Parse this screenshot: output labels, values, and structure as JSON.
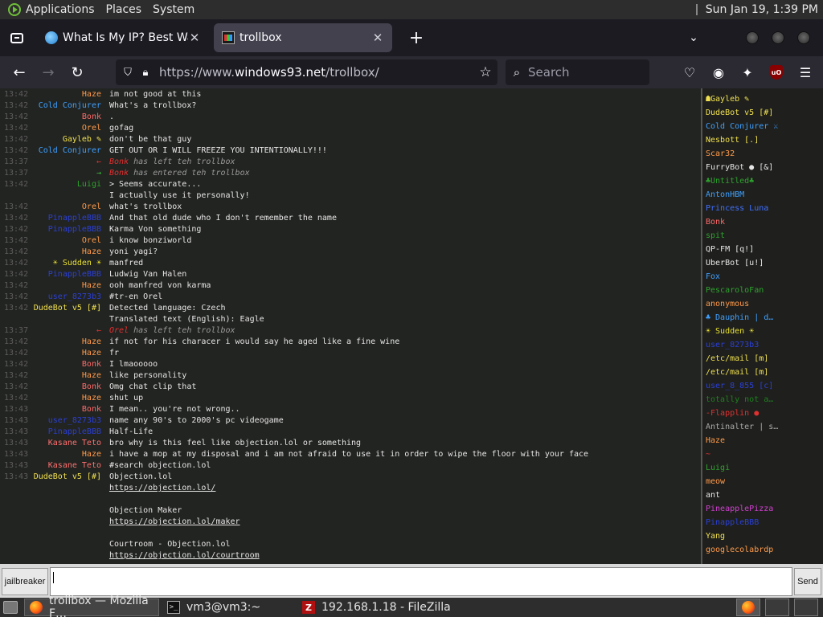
{
  "panel": {
    "menus": [
      "Applications",
      "Places",
      "System"
    ],
    "clock": "Sun Jan 19,  1:39 PM"
  },
  "tabs": [
    {
      "title": "What Is My IP? Best Way To",
      "icon": "globe-icon",
      "active": false
    },
    {
      "title": "trollbox",
      "icon": "trollbox-icon",
      "active": true
    }
  ],
  "nav": {
    "url_prefix": "https://www.",
    "url_host": "windows93.net",
    "url_path": "/trollbox/",
    "search_placeholder": "Search"
  },
  "messages": [
    {
      "time": "13:42",
      "nick": "Haze",
      "color": "#ff9a4a",
      "text": "im not good at this"
    },
    {
      "time": "13:42",
      "nick": "Cold Conjurer",
      "color": "#3fa0ff",
      "text": "What's a trollbox?"
    },
    {
      "time": "13:42",
      "nick": "Bonk",
      "color": "#ff6a6a",
      "text": "."
    },
    {
      "time": "13:42",
      "nick": "Orel",
      "color": "#ff9a4a",
      "text": "gofag"
    },
    {
      "time": "13:42",
      "nick": "Gayleb ✎",
      "color": "#f0e050",
      "text": "don't be that guy"
    },
    {
      "time": "13:42",
      "nick": "Cold Conjurer",
      "color": "#3fa0ff",
      "text": "GET OUT OR I WILL FREEZE YOU INTENTIONALLY!!!"
    },
    {
      "time": "13:37",
      "arrow": "←",
      "arrowColor": "#e03030",
      "sys": true,
      "who": "Bonk",
      "text": "has left teh trollbox"
    },
    {
      "time": "13:37",
      "arrow": "→",
      "arrowColor": "#3cc03c",
      "sys": true,
      "who": "Bonk",
      "text": "has entered teh trollbox"
    },
    {
      "time": "13:42",
      "nick": "Luigi",
      "color": "#2ea22e",
      "text": "> Seems accurate..."
    },
    {
      "time": "",
      "nick": "",
      "color": "#fff",
      "text": "I actually use it personally!"
    },
    {
      "time": "13:42",
      "nick": "Orel",
      "color": "#ff9a4a",
      "text": "what's trollbox"
    },
    {
      "time": "13:42",
      "nick": "PinappleBBB",
      "color": "#2b3fd6",
      "text": "And that old dude who I don't remember the name"
    },
    {
      "time": "13:42",
      "nick": "PinappleBBB",
      "color": "#2b3fd6",
      "text": "Karma Von something"
    },
    {
      "time": "13:42",
      "nick": "Orel",
      "color": "#ff9a4a",
      "text": "i know bonziworld"
    },
    {
      "time": "13:42",
      "nick": "Haze",
      "color": "#ff9a4a",
      "text": "yoni yagi?"
    },
    {
      "time": "13:42",
      "nick": "☀ Sudden ☀",
      "color": "#e8e030",
      "text": "manfred"
    },
    {
      "time": "13:42",
      "nick": "PinappleBBB",
      "color": "#2b3fd6",
      "text": "Ludwig Van Halen"
    },
    {
      "time": "13:42",
      "nick": "Haze",
      "color": "#ff9a4a",
      "text": "ooh manfred von karma"
    },
    {
      "time": "13:42",
      "nick": "user_8273b3",
      "color": "#2b3fd6",
      "text": "#tr-en Orel"
    },
    {
      "time": "13:42",
      "nick": "DudeBot v5 [#]",
      "color": "#f0e050",
      "text": "Detected language: Czech"
    },
    {
      "time": "",
      "nick": "",
      "color": "#fff",
      "text": "Translated text (English): Eagle"
    },
    {
      "time": "13:37",
      "arrow": "←",
      "arrowColor": "#e03030",
      "sys": true,
      "who": "Orel",
      "text": "has left teh trollbox"
    },
    {
      "time": "13:42",
      "nick": "Haze",
      "color": "#ff9a4a",
      "text": "if not for his characer i would say he aged like a fine wine"
    },
    {
      "time": "13:42",
      "nick": "Haze",
      "color": "#ff9a4a",
      "text": "fr"
    },
    {
      "time": "13:42",
      "nick": "Bonk",
      "color": "#ff6a6a",
      "text": "I lmaooooo"
    },
    {
      "time": "13:42",
      "nick": "Haze",
      "color": "#ff9a4a",
      "text": "like personality"
    },
    {
      "time": "13:42",
      "nick": "Bonk",
      "color": "#ff6a6a",
      "text": "Omg chat clip that"
    },
    {
      "time": "13:42",
      "nick": "Haze",
      "color": "#ff9a4a",
      "text": "shut up"
    },
    {
      "time": "13:43",
      "nick": "Bonk",
      "color": "#ff6a6a",
      "text": "I mean.. you're not wrong.."
    },
    {
      "time": "13:43",
      "nick": "user_8273b3",
      "color": "#2b3fd6",
      "text": "name any 90's to 2000's pc videogame"
    },
    {
      "time": "13:43",
      "nick": "PinappleBBB",
      "color": "#2b3fd6",
      "text": "Half-Life"
    },
    {
      "time": "13:43",
      "nick": "Kasane Teto",
      "color": "#ff7070",
      "text": "bro why is this feel like objection.lol or something"
    },
    {
      "time": "13:43",
      "nick": "Haze",
      "color": "#ff9a4a",
      "text": "i have a mop at my disposal and i am not afraid to use it in order to wipe the floor with your face"
    },
    {
      "time": "13:43",
      "nick": "Kasane Teto",
      "color": "#ff7070",
      "text": "#search objection.lol"
    },
    {
      "time": "13:43",
      "nick": "DudeBot v5 [#]",
      "color": "#f0e050",
      "text": "Objection.lol"
    },
    {
      "time": "",
      "nick": "",
      "color": "#fff",
      "text": "https://objection.lol/",
      "link": true
    },
    {
      "time": "",
      "nick": "",
      "color": "#fff",
      "text": ""
    },
    {
      "time": "",
      "nick": "",
      "color": "#fff",
      "text": "Objection Maker"
    },
    {
      "time": "",
      "nick": "",
      "color": "#fff",
      "text": "https://objection.lol/maker",
      "link": true
    },
    {
      "time": "",
      "nick": "",
      "color": "#fff",
      "text": ""
    },
    {
      "time": "",
      "nick": "",
      "color": "#fff",
      "text": "Courtroom - Objection.lol"
    },
    {
      "time": "",
      "nick": "",
      "color": "#fff",
      "text": "https://objection.lol/courtroom",
      "link": true
    }
  ],
  "users": [
    {
      "name": "☗Gayleb ✎",
      "color": "#f0e050"
    },
    {
      "name": "DudeBot v5 [#]",
      "color": "#f0e050"
    },
    {
      "name": "Cold Conjurer ⚔",
      "color": "#3fa0ff"
    },
    {
      "name": "Nesbott [.]",
      "color": "#f0e050"
    },
    {
      "name": "Scar32",
      "color": "#ff9a4a"
    },
    {
      "name": "FurryBot ● [&]",
      "color": "#e6e6e6"
    },
    {
      "name": "♣Untitled♣",
      "color": "#2ea22e"
    },
    {
      "name": "AntonHBM",
      "color": "#3fa0ff"
    },
    {
      "name": "Princess Luna",
      "color": "#3f6fff"
    },
    {
      "name": "Bonk",
      "color": "#ff6a6a"
    },
    {
      "name": "spit",
      "color": "#2ea22e"
    },
    {
      "name": "QP-FM [q!]",
      "color": "#e6e6e6"
    },
    {
      "name": "UberBot [u!]",
      "color": "#e6e6e6"
    },
    {
      "name": "Fox",
      "color": "#3fa0ff"
    },
    {
      "name": "PescaroloFan",
      "color": "#2ea22e"
    },
    {
      "name": "anonymous",
      "color": "#ff9a4a"
    },
    {
      "name": "♣ Dauphin | d…",
      "color": "#3fa0ff"
    },
    {
      "name": "☀ Sudden ☀",
      "color": "#e8e030"
    },
    {
      "name": "user_8273b3",
      "color": "#2b3fd6"
    },
    {
      "name": "/etc/mail [m]",
      "color": "#f0e050"
    },
    {
      "name": "/etc/mail [m]",
      "color": "#f0e050"
    },
    {
      "name": "user_8_855 [c]",
      "color": "#2b3fd6"
    },
    {
      "name": "totally not a…",
      "color": "#1f7f1f"
    },
    {
      "name": "-Flapplin ●",
      "color": "#e03030"
    },
    {
      "name": "Antinalter | s…",
      "color": "#aaaaaa"
    },
    {
      "name": "Haze",
      "color": "#ff9a4a"
    },
    {
      "name": "~",
      "color": "#e03030"
    },
    {
      "name": "Luigi",
      "color": "#2ea22e"
    },
    {
      "name": "meow",
      "color": "#ff9a4a"
    },
    {
      "name": "ant",
      "color": "#e6e6e6"
    },
    {
      "name": "PineapplePizza",
      "color": "#d040d0"
    },
    {
      "name": "PinappleBBB",
      "color": "#2b3fd6"
    },
    {
      "name": "Yang",
      "color": "#f0e050"
    },
    {
      "name": "googlecolabrdp",
      "color": "#ff9a4a"
    }
  ],
  "input": {
    "nick_button": "jailbreaker",
    "send_button": "Send",
    "value": ""
  },
  "taskbar": {
    "items": [
      {
        "label": "trollbox — Mozilla F…",
        "icon": "firefox-icon",
        "active": true
      },
      {
        "label": "vm3@vm3:~",
        "icon": "terminal-icon",
        "active": false
      },
      {
        "label": "192.168.1.18 - FileZilla",
        "icon": "filezilla-icon",
        "active": false
      }
    ]
  }
}
